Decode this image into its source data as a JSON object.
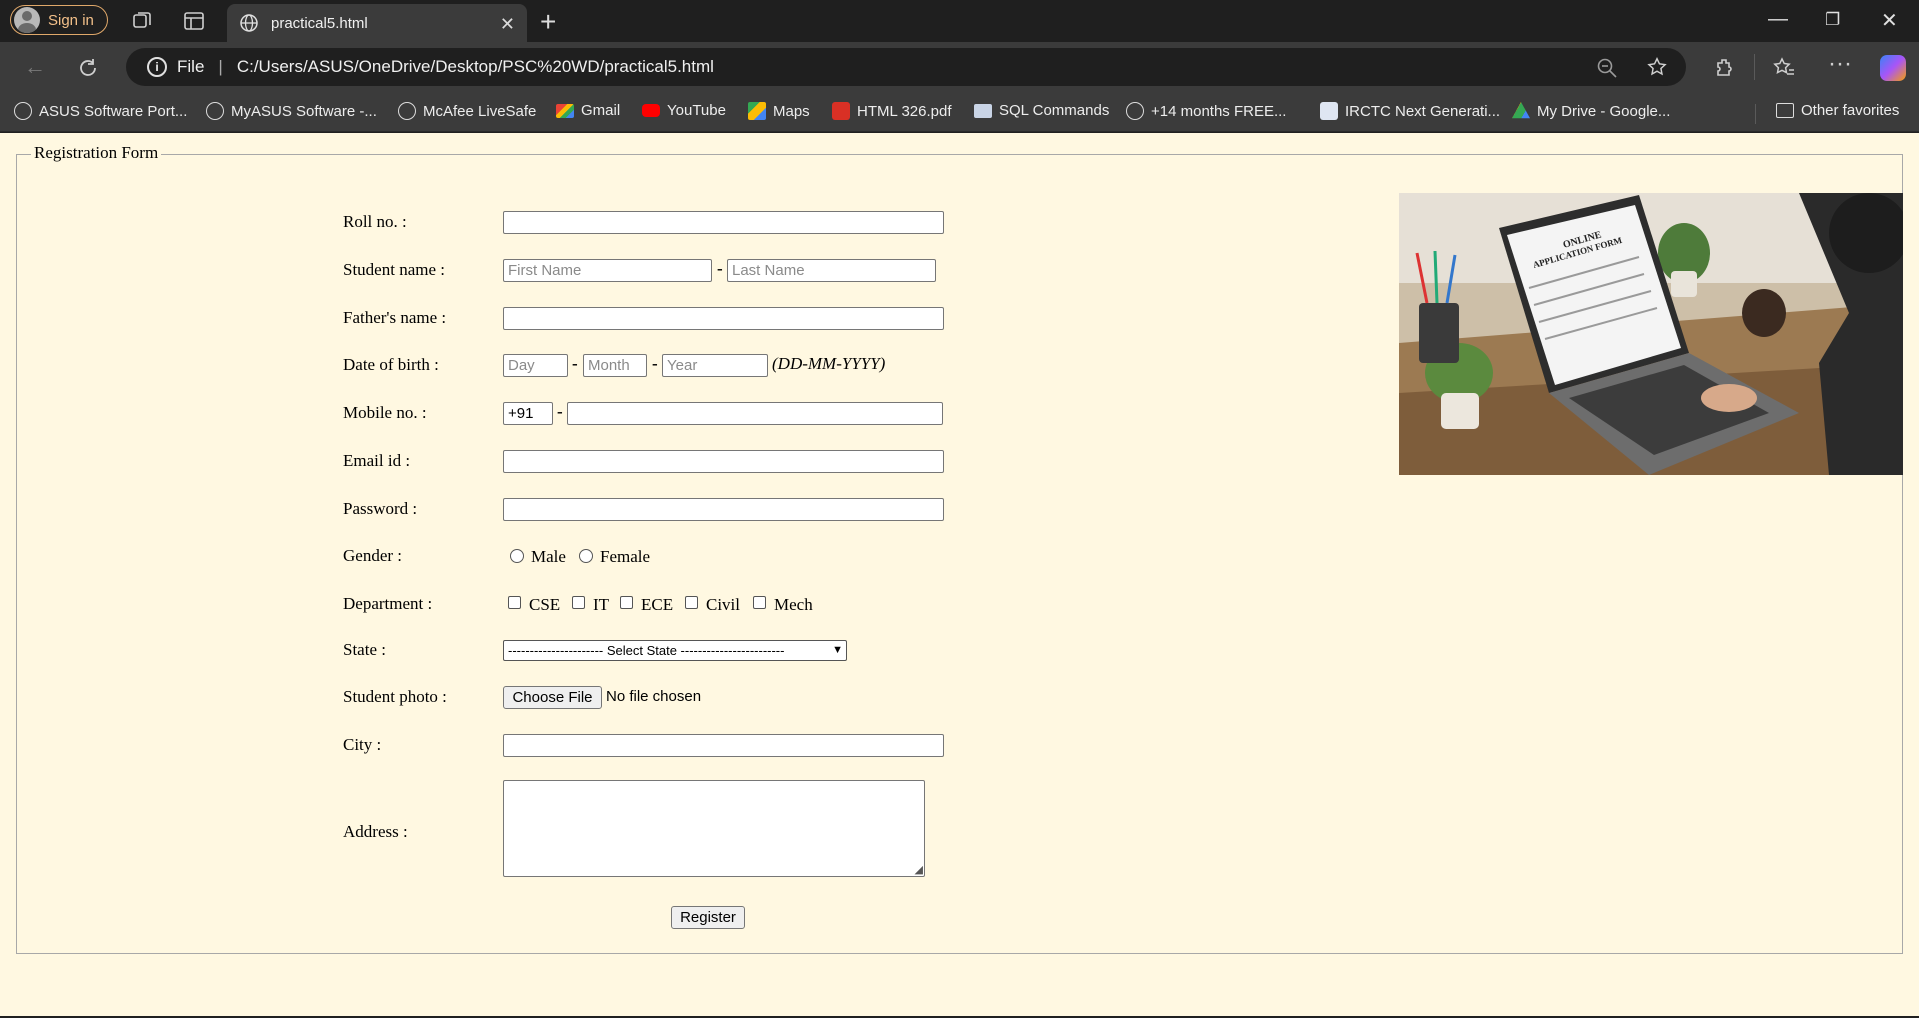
{
  "browser": {
    "signin_label": "Sign in",
    "tab_title": "practical5.html",
    "address_chip": "File",
    "address_url": "C:/Users/ASUS/OneDrive/Desktop/PSC%20WD/practical5.html",
    "bookmarks": [
      {
        "label": "ASUS Software Port...",
        "icon": "globe-icon"
      },
      {
        "label": "MyASUS Software -...",
        "icon": "globe-icon"
      },
      {
        "label": "McAfee LiveSafe",
        "icon": "globe-icon"
      },
      {
        "label": "Gmail",
        "icon": "gmail-icon"
      },
      {
        "label": "YouTube",
        "icon": "youtube-icon"
      },
      {
        "label": "Maps",
        "icon": "maps-icon"
      },
      {
        "label": "HTML 326.pdf",
        "icon": "pdf-icon"
      },
      {
        "label": "SQL Commands",
        "icon": "sql-icon"
      },
      {
        "label": "+14 months FREE...",
        "icon": "globe-icon"
      },
      {
        "label": "IRCTC Next Generati...",
        "icon": "irctc-icon"
      },
      {
        "label": "My Drive - Google...",
        "icon": "drive-icon"
      },
      {
        "label": "Other favorites",
        "icon": "folder-icon"
      }
    ]
  },
  "form": {
    "legend": "Registration Form",
    "labels": {
      "roll": "Roll no. :",
      "student_name": "Student name :",
      "father_name": "Father's name :",
      "dob": "Date of birth :",
      "mobile": "Mobile no. :",
      "email": "Email id :",
      "password": "Password :",
      "gender": "Gender :",
      "department": "Department :",
      "state": "State :",
      "photo": "Student photo :",
      "city": "City :",
      "address": "Address :"
    },
    "placeholders": {
      "first_name": "First Name",
      "last_name": "Last Name",
      "day": "Day",
      "month": "Month",
      "year": "Year"
    },
    "dash": "-",
    "dob_hint": "(DD-MM-YYYY)",
    "mobile_prefix": "+91",
    "gender_options": [
      "Male",
      "Female"
    ],
    "department_options": [
      "CSE",
      "IT",
      "ECE",
      "Civil",
      "Mech"
    ],
    "state_select": "---------------------- Select State ------------------------",
    "file_button": "Choose File",
    "file_status": "No file chosen",
    "submit": "Register"
  },
  "image": {
    "screen_title": "ONLINE",
    "screen_subtitle": "APPLICATION FORM"
  }
}
